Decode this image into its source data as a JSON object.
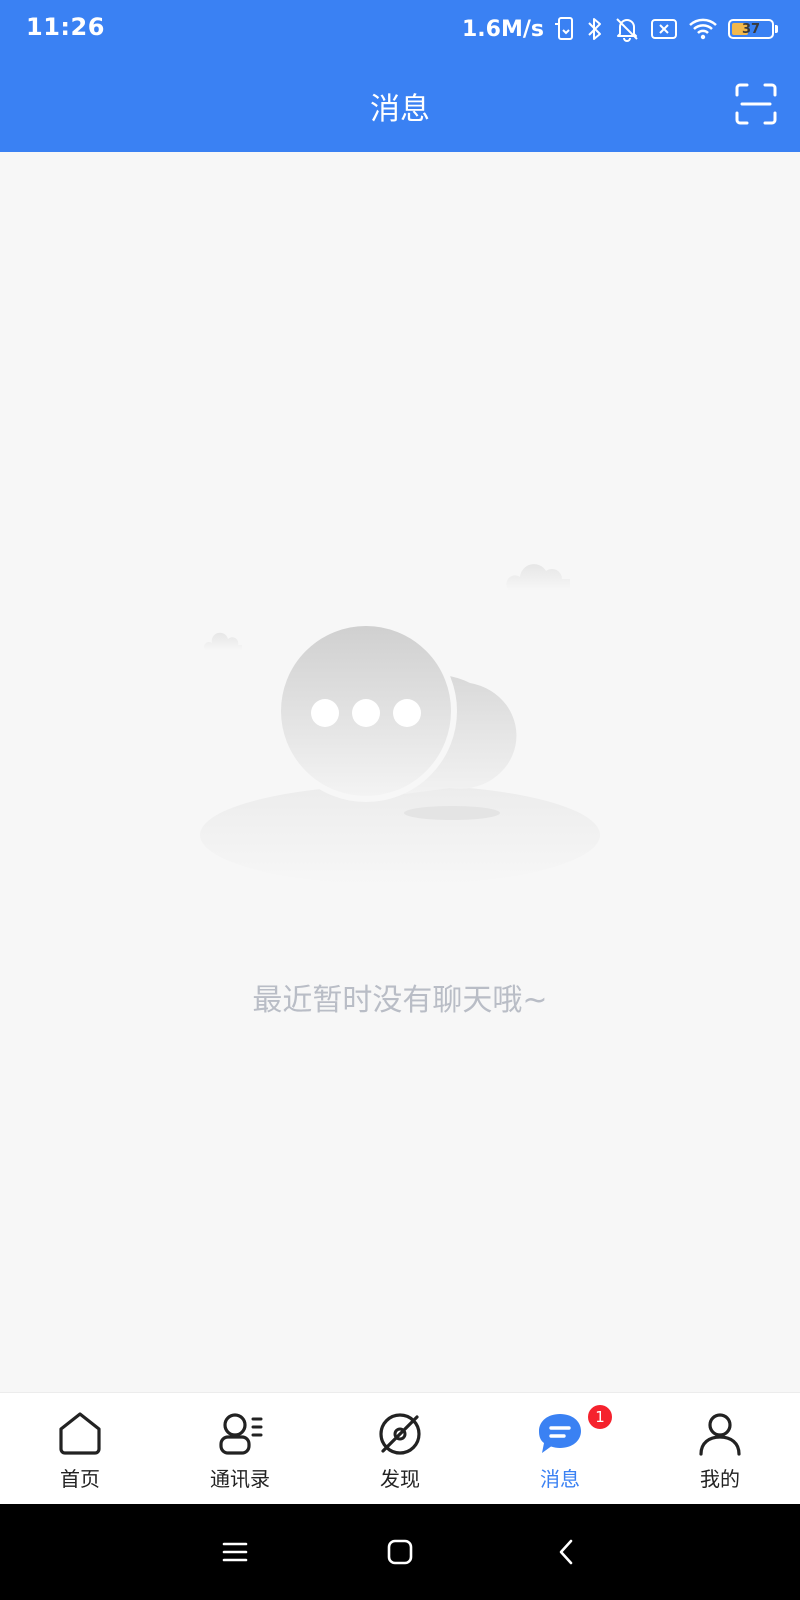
{
  "status_bar": {
    "time": "11:26",
    "net_speed": "1.6M/s",
    "battery_level": "37",
    "icons": [
      "phone-sync-icon",
      "bluetooth-icon",
      "mute-bell-icon",
      "sim-off-icon",
      "wifi-icon",
      "battery-icon"
    ]
  },
  "header": {
    "title": "消息",
    "action_icon": "scan-icon"
  },
  "empty_state": {
    "message": "最近暂时没有聊天哦~",
    "illustration": "chat-bubbles-illustration"
  },
  "tabbar": {
    "active_index": 3,
    "tabs": [
      {
        "label": "首页",
        "icon": "home-icon"
      },
      {
        "label": "通讯录",
        "icon": "contacts-icon"
      },
      {
        "label": "发现",
        "icon": "discover-icon"
      },
      {
        "label": "消息",
        "icon": "message-icon",
        "badge": "1"
      },
      {
        "label": "我的",
        "icon": "profile-icon"
      }
    ]
  },
  "system_nav": {
    "buttons": [
      "menu-icon",
      "home-square-icon",
      "back-icon"
    ]
  },
  "colors": {
    "primary": "#3a81f3",
    "background": "#f7f7f7",
    "badge": "#f5222d",
    "empty_text": "#b9bdc6"
  }
}
